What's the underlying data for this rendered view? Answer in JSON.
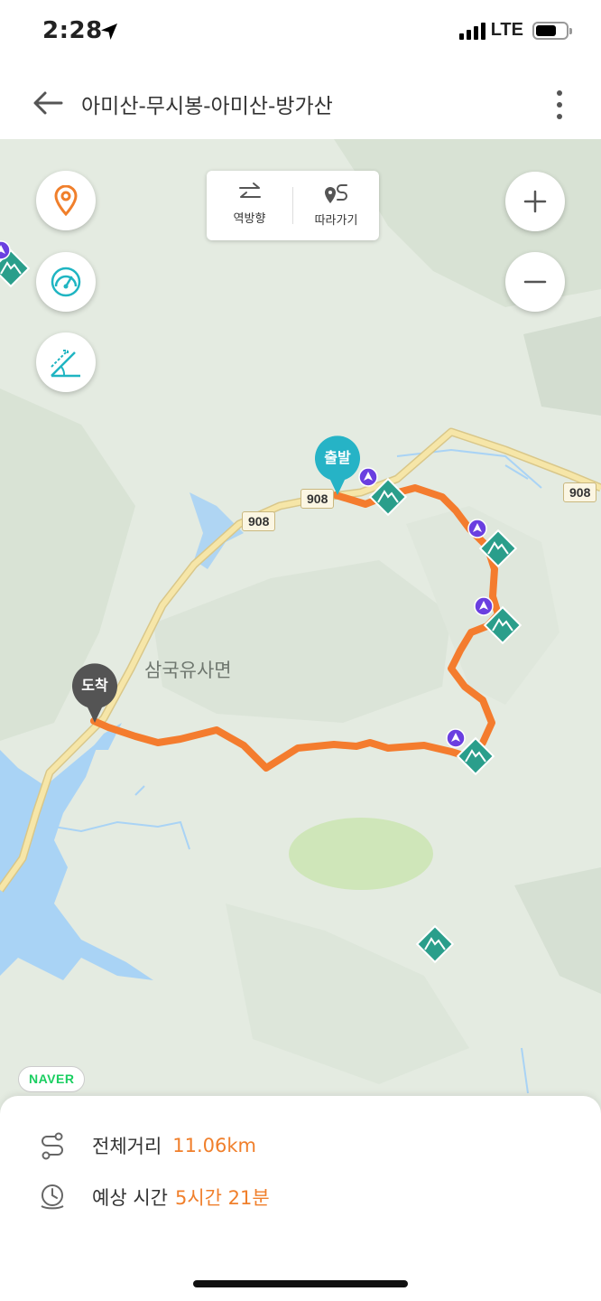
{
  "status_bar": {
    "time": "2:28",
    "network": "LTE",
    "location_icon": "location-arrow-icon",
    "battery_level": 0.7
  },
  "header": {
    "title": "아미산-무시봉-아미산-방가산",
    "back_icon": "back-arrow-icon",
    "more_icon": "more-vertical-icon"
  },
  "map_controls": {
    "left": [
      {
        "icon": "location-pin-icon"
      },
      {
        "icon": "gauge-icon"
      },
      {
        "icon": "slope-icon"
      }
    ],
    "zoom_in_icon": "plus-icon",
    "zoom_out_icon": "minus-icon",
    "direction_panel": {
      "reverse_label": "역방향",
      "follow_label": "따라가기"
    }
  },
  "map": {
    "road_labels": [
      "908",
      "908",
      "908"
    ],
    "place_label": "삼국유사면",
    "start_label": "출발",
    "end_label": "도착",
    "provider": "NAVER",
    "colors": {
      "route": "#f47c2e",
      "start_pin": "#26b3c6",
      "end_pin": "#545454",
      "peak_marker": "#2a9e8b",
      "checkpoint": "#6a3fe0",
      "water": "#a9d3f5",
      "road": "#f6e6a8"
    }
  },
  "summary": {
    "distance_label": "전체거리",
    "distance_value": "11.06km",
    "time_label": "예상 시간",
    "time_value": "5시간 21분"
  }
}
